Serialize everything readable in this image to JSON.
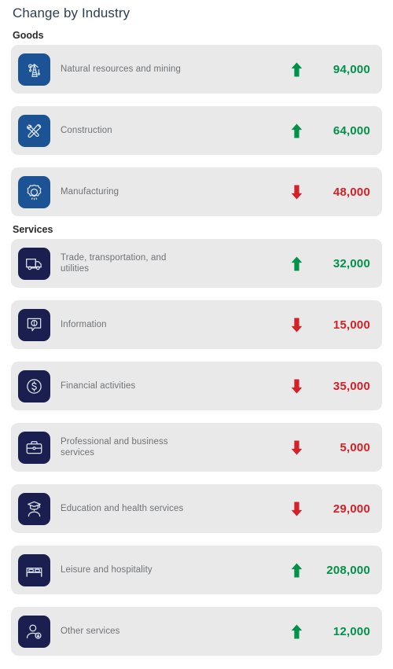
{
  "header": {
    "title": "Change by Industry"
  },
  "colors": {
    "increase": "#00914a",
    "decrease": "#d42027",
    "goods_icon_bg": "#1c5394",
    "services_icon_bg": "#1b1f4f",
    "row_bg": "#e9e9e9",
    "title": "#2c3e56"
  },
  "groups": [
    {
      "heading": "Goods",
      "icon_style": "goods",
      "rows": [
        {
          "label_line1": "Natural resources and mining",
          "label_line2": "",
          "icon": "oil-derrick-icon",
          "direction": "up",
          "direction_icon": "arrow-up-icon",
          "value": "94,000"
        },
        {
          "label_line1": "Construction",
          "label_line2": "",
          "icon": "hammer-wrench-icon",
          "direction": "up",
          "direction_icon": "arrow-up-icon",
          "value": "64,000"
        },
        {
          "label_line1": "Manufacturing",
          "label_line2": "",
          "icon": "gear-icon",
          "direction": "down",
          "direction_icon": "arrow-down-icon",
          "value": "48,000"
        }
      ]
    },
    {
      "heading": "Services",
      "icon_style": "services",
      "rows": [
        {
          "label_line1": "Trade, transportation, and",
          "label_line2": "utilities",
          "icon": "truck-icon",
          "direction": "up",
          "direction_icon": "arrow-up-icon",
          "value": "32,000"
        },
        {
          "label_line1": "Information",
          "label_line2": "",
          "icon": "info-bubble-icon",
          "direction": "down",
          "direction_icon": "arrow-down-icon",
          "value": "15,000"
        },
        {
          "label_line1": "Financial activities",
          "label_line2": "",
          "icon": "dollar-circle-icon",
          "direction": "down",
          "direction_icon": "arrow-down-icon",
          "value": "35,000"
        },
        {
          "label_line1": "Professional and business",
          "label_line2": "services",
          "icon": "briefcase-icon",
          "direction": "down",
          "direction_icon": "arrow-down-icon",
          "value": "5,000"
        },
        {
          "label_line1": "Education and health services",
          "label_line2": "",
          "icon": "graduate-icon",
          "direction": "down",
          "direction_icon": "arrow-down-icon",
          "value": "29,000"
        },
        {
          "label_line1": "Leisure and hospitality",
          "label_line2": "",
          "icon": "bed-icon",
          "direction": "up",
          "direction_icon": "arrow-up-icon",
          "value": "208,000"
        },
        {
          "label_line1": "Other services",
          "label_line2": "",
          "icon": "person-add-icon",
          "direction": "up",
          "direction_icon": "arrow-up-icon",
          "value": "12,000"
        }
      ]
    }
  ]
}
